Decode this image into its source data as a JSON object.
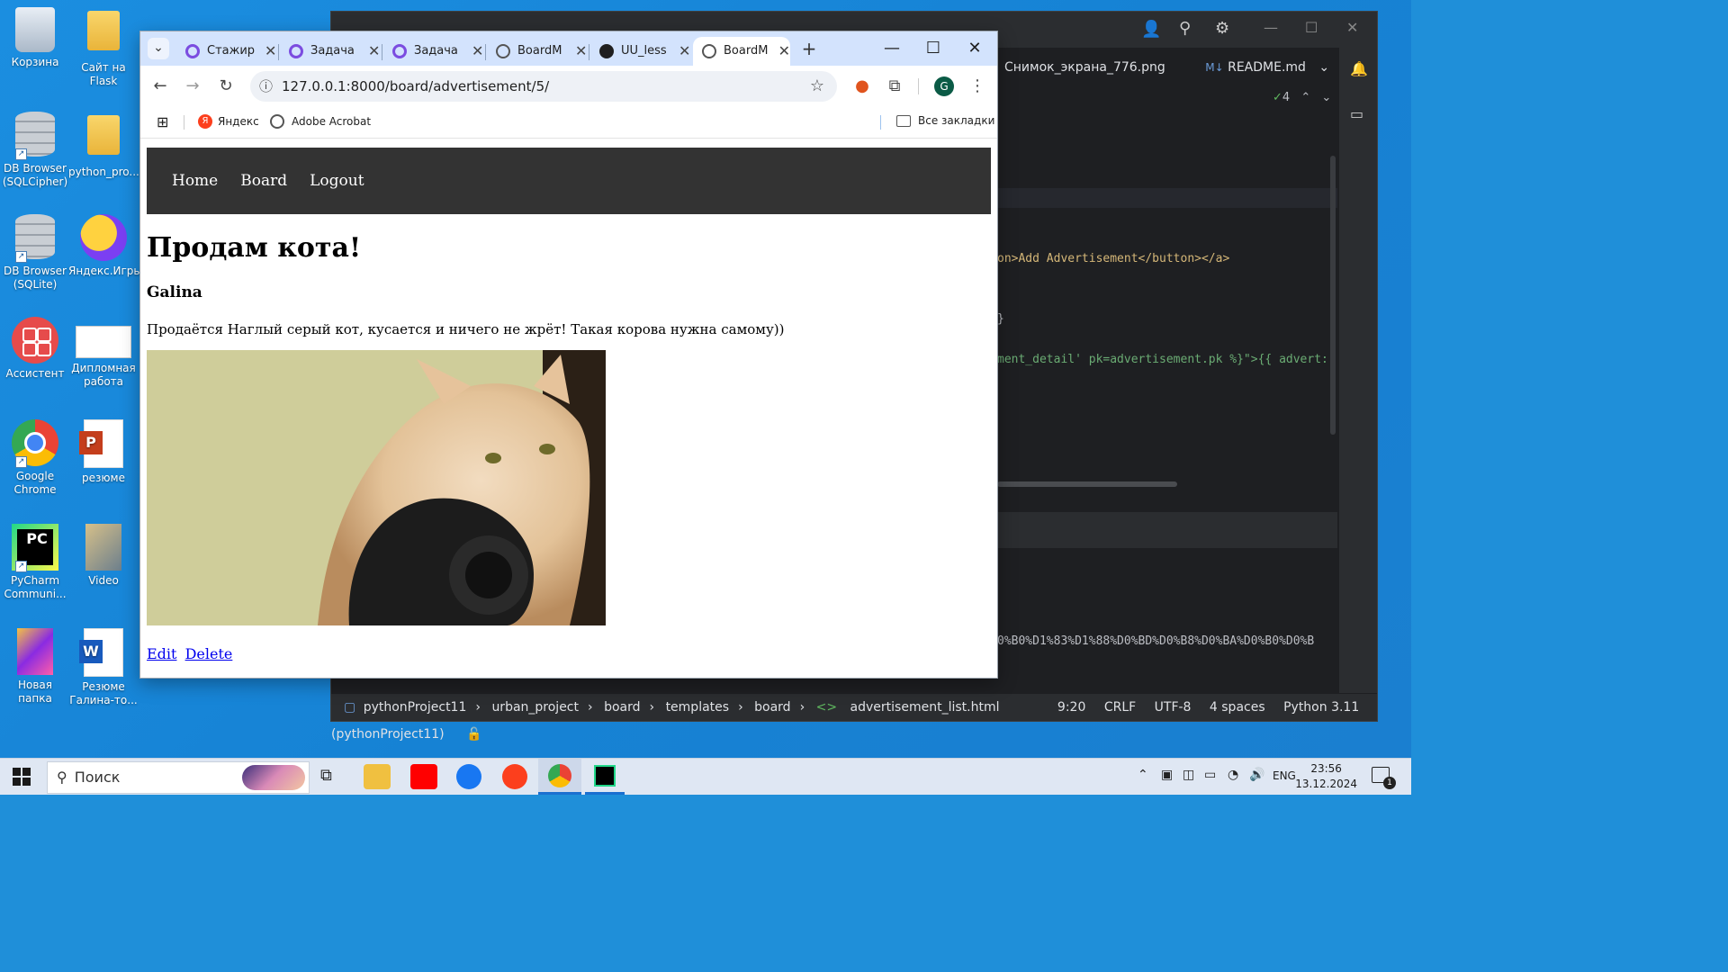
{
  "desktop": {
    "icons": [
      {
        "label": "Корзина",
        "icon": "recycle-bin-icon"
      },
      {
        "label": "Сайт на Flask",
        "icon": "folder-icon"
      },
      {
        "label": "DB Browser (SQLCipher)",
        "icon": "database-icon"
      },
      {
        "label": "python_pro...",
        "icon": "folder-icon"
      },
      {
        "label": "DB Browser (SQLite)",
        "icon": "database-icon"
      },
      {
        "label": "Яндекс.Игры",
        "icon": "gamepad-icon"
      },
      {
        "label": "Ассистент",
        "icon": "assistant-icon"
      },
      {
        "label": "Дипломная работа",
        "icon": "document-icon"
      },
      {
        "label": "Google Chrome",
        "icon": "chrome-icon"
      },
      {
        "label": "резюме",
        "icon": "powerpoint-icon"
      },
      {
        "label": "PyCharm Communi...",
        "icon": "pycharm-icon"
      },
      {
        "label": "Video",
        "icon": "video-folder-icon"
      },
      {
        "label": "Новая папка",
        "icon": "folder-icon"
      },
      {
        "label": "Резюме Галина-то...",
        "icon": "word-icon"
      }
    ]
  },
  "ide": {
    "tab_screenshot": "Снимок_экрана_776.png",
    "tab_readme": "README.md",
    "badge_count": "4",
    "code_line1": "on>Add Advertisement</button></a>",
    "code_line2": "}",
    "code_line3": "ment_detail' pk=advertisement.pk %}\">{{ advert:",
    "code_line4": "0%B0%D1%83%D1%88%D0%BD%D0%B8%D0%BA%D0%B0%D0%B",
    "breadcrumb": [
      "pythonProject11",
      "urban_project",
      "board",
      "templates",
      "board",
      "advertisement_list.html"
    ],
    "status": {
      "position": "9:20",
      "line_sep": "CRLF",
      "encoding": "UTF-8",
      "indent": "4 spaces",
      "interpreter": "Python 3.11 (pythonProject11)"
    }
  },
  "browser": {
    "tabs": [
      {
        "title": "Стажир",
        "icon": "workspace-icon"
      },
      {
        "title": "Задача",
        "icon": "workspace-icon"
      },
      {
        "title": "Задача",
        "icon": "workspace-icon"
      },
      {
        "title": "BoardM",
        "icon": "globe-icon"
      },
      {
        "title": "UU_less",
        "icon": "github-icon"
      },
      {
        "title": "BoardM",
        "icon": "globe-icon",
        "active": true
      }
    ],
    "url": "127.0.0.1:8000/board/advertisement/5/",
    "profile_initial": "G",
    "bookmarks": [
      {
        "label": "Яндекс",
        "icon": "yandex-icon"
      },
      {
        "label": "Adobe Acrobat",
        "icon": "globe-icon"
      }
    ],
    "all_bookmarks": "Все закладки"
  },
  "page": {
    "nav": [
      "Home",
      "Board",
      "Logout"
    ],
    "title": "Продам кота!",
    "author": "Galina",
    "description": "Продаётся Наглый серый кот, кусается и ничего не жрёт! Такая корова нужна самому))",
    "edit_label": "Edit",
    "delete_label": "Delete"
  },
  "taskbar": {
    "search_placeholder": "Поиск",
    "language": "ENG",
    "time": "23:56",
    "date": "13.12.2024",
    "notification_count": "1"
  }
}
